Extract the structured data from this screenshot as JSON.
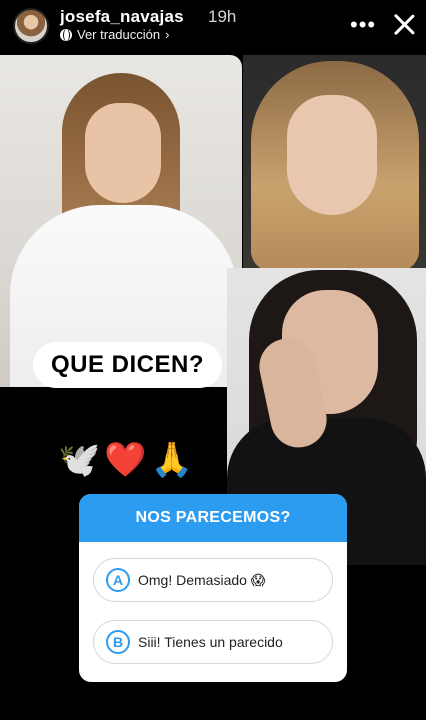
{
  "header": {
    "username": "josefa_navajas",
    "time": "19h",
    "translation_label": "Ver traducción"
  },
  "stickers": {
    "question_text": "QUE DICEN?",
    "emojis": "🕊️❤️🙏"
  },
  "poll": {
    "title": "NOS PARECEMOS?",
    "options": [
      {
        "letter": "A",
        "text": "Omg! Demasiado 😱"
      },
      {
        "letter": "B",
        "text": "Siii! Tienes un  parecido"
      }
    ],
    "accent": "#2c9cf0"
  },
  "icons": [
    "globe-icon",
    "chevron-right-icon",
    "more-options-icon",
    "close-icon"
  ]
}
